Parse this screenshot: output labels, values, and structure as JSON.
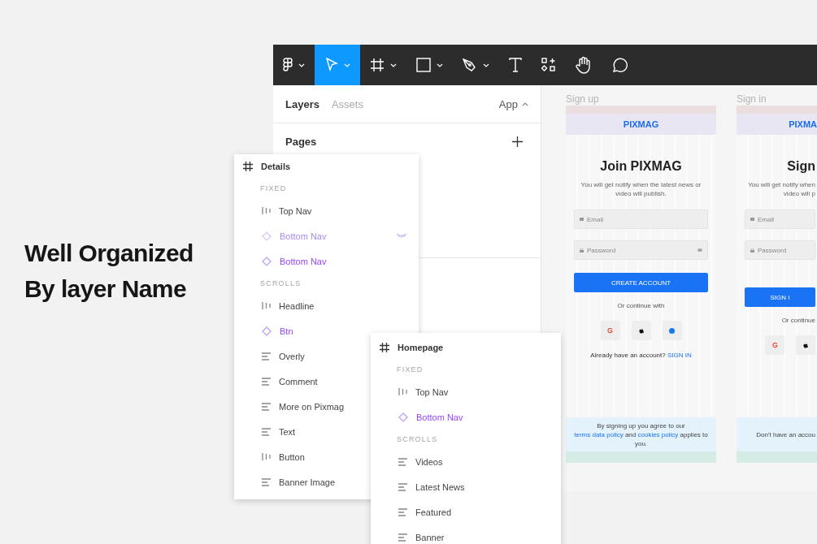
{
  "headline": [
    "Well Organized",
    "By layer Name"
  ],
  "toolbar": {
    "tools": [
      {
        "kind": "logo",
        "menu": true,
        "selected": false
      },
      {
        "kind": "move",
        "menu": true,
        "selected": true
      },
      {
        "kind": "frame",
        "menu": true,
        "selected": false
      },
      {
        "kind": "rectangle",
        "menu": true,
        "selected": false
      },
      {
        "kind": "pen",
        "menu": true,
        "selected": false
      },
      {
        "kind": "text",
        "menu": false,
        "selected": false
      },
      {
        "kind": "resources",
        "menu": false,
        "selected": false
      },
      {
        "kind": "hand",
        "menu": false,
        "selected": false
      },
      {
        "kind": "comment",
        "menu": false,
        "selected": false
      }
    ]
  },
  "layers_panel": {
    "tabs": [
      {
        "label": "Layers",
        "selected": true
      },
      {
        "label": "Assets",
        "selected": false
      }
    ],
    "page_menu": "App",
    "pages_label": "Pages"
  },
  "layer_popups": [
    {
      "frame": "Details",
      "rows": [
        {
          "kind": "section",
          "label": "FIXED"
        },
        {
          "kind": "autolayout",
          "label": "Top Nav",
          "hidden": false
        },
        {
          "kind": "component",
          "label": "Bottom Nav",
          "hidden": true
        },
        {
          "kind": "component",
          "label": "Bottom Nav",
          "hidden": false
        },
        {
          "kind": "section",
          "label": "SCROLLS"
        },
        {
          "kind": "autolayout",
          "label": "Headline",
          "hidden": false
        },
        {
          "kind": "component",
          "label": "Btn",
          "hidden": false
        },
        {
          "kind": "text",
          "label": "Overly",
          "hidden": false
        },
        {
          "kind": "text",
          "label": "Comment",
          "hidden": false
        },
        {
          "kind": "text",
          "label": "More on Pixmag",
          "hidden": false
        },
        {
          "kind": "text",
          "label": "Text",
          "hidden": false
        },
        {
          "kind": "autolayout",
          "label": "Button",
          "hidden": false
        },
        {
          "kind": "text",
          "label": "Banner Image",
          "hidden": false
        }
      ]
    },
    {
      "frame": "Homepage",
      "rows": [
        {
          "kind": "section",
          "label": "FIXED"
        },
        {
          "kind": "autolayout",
          "label": "Top Nav",
          "hidden": false
        },
        {
          "kind": "component",
          "label": "Bottom Nav",
          "hidden": false
        },
        {
          "kind": "section",
          "label": "SCROLLS"
        },
        {
          "kind": "text",
          "label": "Videos",
          "hidden": false
        },
        {
          "kind": "text",
          "label": "Latest News",
          "hidden": false
        },
        {
          "kind": "text",
          "label": "Featured",
          "hidden": false
        },
        {
          "kind": "text",
          "label": "Banner",
          "hidden": false
        }
      ]
    }
  ],
  "canvas": {
    "frames": [
      {
        "label": "Sign up",
        "brand": "PIXMAG",
        "title": "Join PIXMAG",
        "subtitle": [
          "You will get notify when the latest news or",
          "video will publish."
        ],
        "email": "Email",
        "password": "Password",
        "eye_icon": true,
        "button": "CREATE ACCOUNT",
        "alt_text": "Or continue with",
        "social": [
          {
            "kind": "google"
          },
          {
            "kind": "apple"
          },
          {
            "kind": "facebook"
          }
        ],
        "account": [
          {
            "text": "Already have an account? ",
            "link": false
          },
          {
            "text": "SIGN IN",
            "link": true
          }
        ],
        "footer": [
          {
            "text": "By signing up you agree to our ",
            "link": false
          },
          {
            "text": "terms data policy",
            "link": true
          },
          {
            "text": " and ",
            "link": false
          },
          {
            "text": "cookies policy",
            "link": true
          },
          {
            "text": " applies to you.",
            "link": false
          }
        ]
      },
      {
        "label": "Sign in",
        "brand": "PIXMA",
        "title": "Sign",
        "subtitle": [
          "You will get notify when",
          "video will p"
        ],
        "email": "Email",
        "password": "Password",
        "eye_icon": false,
        "button": "SIGN I",
        "alt_text": "Or continue",
        "social": [
          {
            "kind": "google"
          },
          {
            "kind": "apple"
          }
        ],
        "footer": [
          {
            "text": "Don't have an accou",
            "link": false
          }
        ]
      }
    ]
  }
}
